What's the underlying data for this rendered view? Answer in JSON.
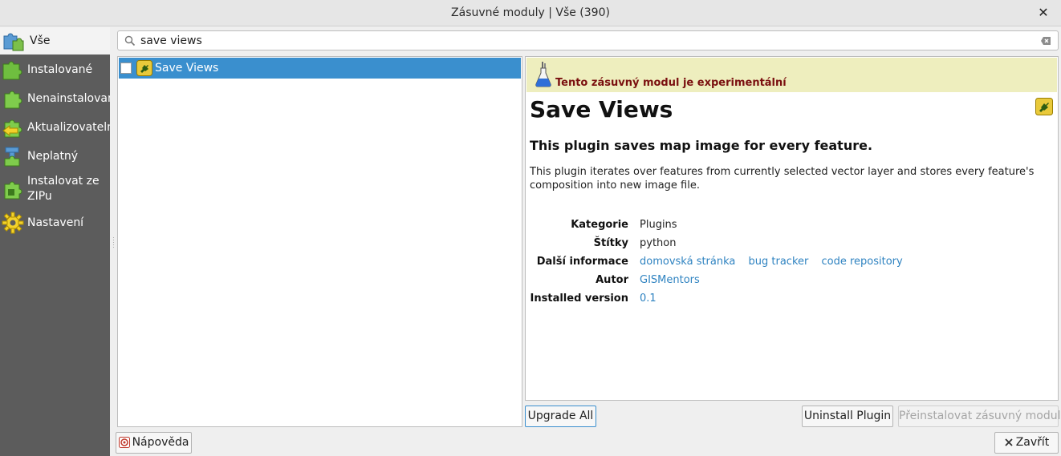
{
  "window": {
    "title": "Zásuvné moduly | Vše (390)",
    "close_glyph": "✕"
  },
  "sidebar": {
    "items": [
      {
        "label": "Vše",
        "icon": "puzzle-all-icon",
        "active": true
      },
      {
        "label": "Instalované",
        "icon": "puzzle-installed-icon"
      },
      {
        "label": "Nenainstalované",
        "icon": "puzzle-not-installed-icon"
      },
      {
        "label": "Aktualizovatelné",
        "icon": "puzzle-upgradeable-icon"
      },
      {
        "label": "Neplatný",
        "icon": "puzzle-invalid-icon"
      },
      {
        "label": "Instalovat ze ZIPu",
        "icon": "zip-install-icon"
      },
      {
        "label": "Nastavení",
        "icon": "gear-icon"
      }
    ]
  },
  "search": {
    "value": "save views"
  },
  "plugin_list": {
    "items": [
      {
        "label": "Save Views",
        "checked": false,
        "selected": true
      }
    ]
  },
  "details": {
    "experimental_notice": "Tento zásuvný modul je experimentální",
    "title": "Save Views",
    "subtitle": "This plugin saves map image for every feature.",
    "description": "This plugin iterates over features from currently selected vector layer and stores every feature's composition into new image file.",
    "meta": {
      "category_label": "Kategorie",
      "category_value": "Plugins",
      "tags_label": "Štítky",
      "tags_value": "python",
      "more_info_label": "Další informace",
      "homepage_link": "domovská stránka",
      "bug_tracker_link": "bug tracker",
      "code_repository_link": "code repository",
      "author_label": "Autor",
      "author_value": "GISMentors",
      "installed_version_label": "Installed version",
      "installed_version_value": "0.1"
    }
  },
  "buttons": {
    "upgrade_all": "Upgrade All",
    "uninstall": "Uninstall Plugin",
    "reinstall": "Přeinstalovat zásuvný modul",
    "help": "Nápověda",
    "close": "Zavřít"
  },
  "colors": {
    "sidebar_bg": "#5c5c5c",
    "selection": "#3a8fce",
    "experimental_bg": "#eeeebe",
    "experimental_text": "#7a0f0f",
    "link": "#2f83c1"
  }
}
